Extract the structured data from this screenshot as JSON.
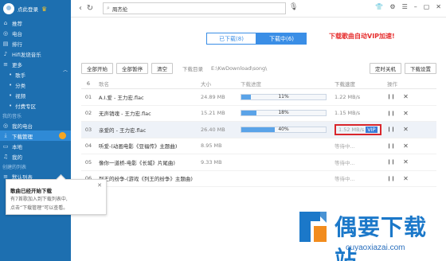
{
  "sidebar": {
    "login_label": "点此登录",
    "items": [
      {
        "label": "推荐",
        "icon": "home-icon"
      },
      {
        "label": "电台",
        "icon": "radio-icon"
      },
      {
        "label": "排行",
        "icon": "chart-icon"
      },
      {
        "label": "Hifi发烧音乐",
        "icon": "hifi-icon"
      }
    ],
    "more_section": "更多",
    "more_items": [
      "歌手",
      "分类",
      "视频",
      "付费专区"
    ],
    "my_music_section": "我的音乐",
    "my_items": [
      {
        "label": "我的电台",
        "icon": "radio-icon"
      },
      {
        "label": "下载管理",
        "icon": "download-icon",
        "active": true
      },
      {
        "label": "本地",
        "icon": "local-icon"
      },
      {
        "label": "我的",
        "icon": "music-icon"
      }
    ],
    "created_section": "创建的列表",
    "playlist_items": [
      {
        "label": "默认列表",
        "icon": "list-icon"
      }
    ]
  },
  "topbar": {
    "search_value": "周杰伦"
  },
  "tabs": [
    {
      "label": "已下载(8)",
      "active": false
    },
    {
      "label": "下载中(6)",
      "active": true
    }
  ],
  "promo_text": "下载歌曲自动VIP加速!",
  "toolbar": {
    "start_all": "全部开始",
    "pause_all": "全部暂停",
    "clear": "清空",
    "dir_label": "下载目录",
    "dir_path": "E:\\KwDownload\\song\\",
    "timer_shutdown": "定时关机",
    "settings": "下载设置"
  },
  "table": {
    "headers": {
      "idx": "6",
      "name": "歌名",
      "size": "大小",
      "progress": "下载进度",
      "speed": "下载速度",
      "ops": "操作"
    },
    "rows": [
      {
        "idx": "01",
        "name": "A.I.爱 - 王力宏.flac",
        "size": "24.89 MB",
        "progress": 11,
        "pct": "11%",
        "speed": "1.22 MB/s"
      },
      {
        "idx": "02",
        "name": "无声销魂 - 王力宏.flac",
        "size": "15.21 MB",
        "progress": 18,
        "pct": "18%",
        "speed": "1.15 MB/s"
      },
      {
        "idx": "03",
        "name": "亲爱的 - 王力宏.flac",
        "size": "26.40 MB",
        "progress": 40,
        "pct": "40%",
        "speed": "1.52 MB/s",
        "speed_highlight": "VIP"
      },
      {
        "idx": "04",
        "name": "听爱-(动画电影《豆福传》主题曲)",
        "size": "8.95 MB",
        "progress": 0,
        "pct": "",
        "speed": "等待中..."
      },
      {
        "idx": "05",
        "name": "像你一道桥-电影《长城》片尾曲)",
        "size": "9.33 MB",
        "progress": 0,
        "pct": "",
        "speed": "等待中..."
      },
      {
        "idx": "06",
        "name": "列王的纷争-(游戏《列王的纷争》主题曲)",
        "size": "",
        "progress": 0,
        "pct": "",
        "speed": "等待中..."
      }
    ]
  },
  "popup": {
    "title": "歌曲已经开始下载",
    "line1": "有7首歌加入到下载列表中,",
    "line2": "点击“下载管理”可以查看。"
  },
  "watermark": {
    "text": "偶要下载站",
    "url": "ouyaoxiazai.com"
  }
}
